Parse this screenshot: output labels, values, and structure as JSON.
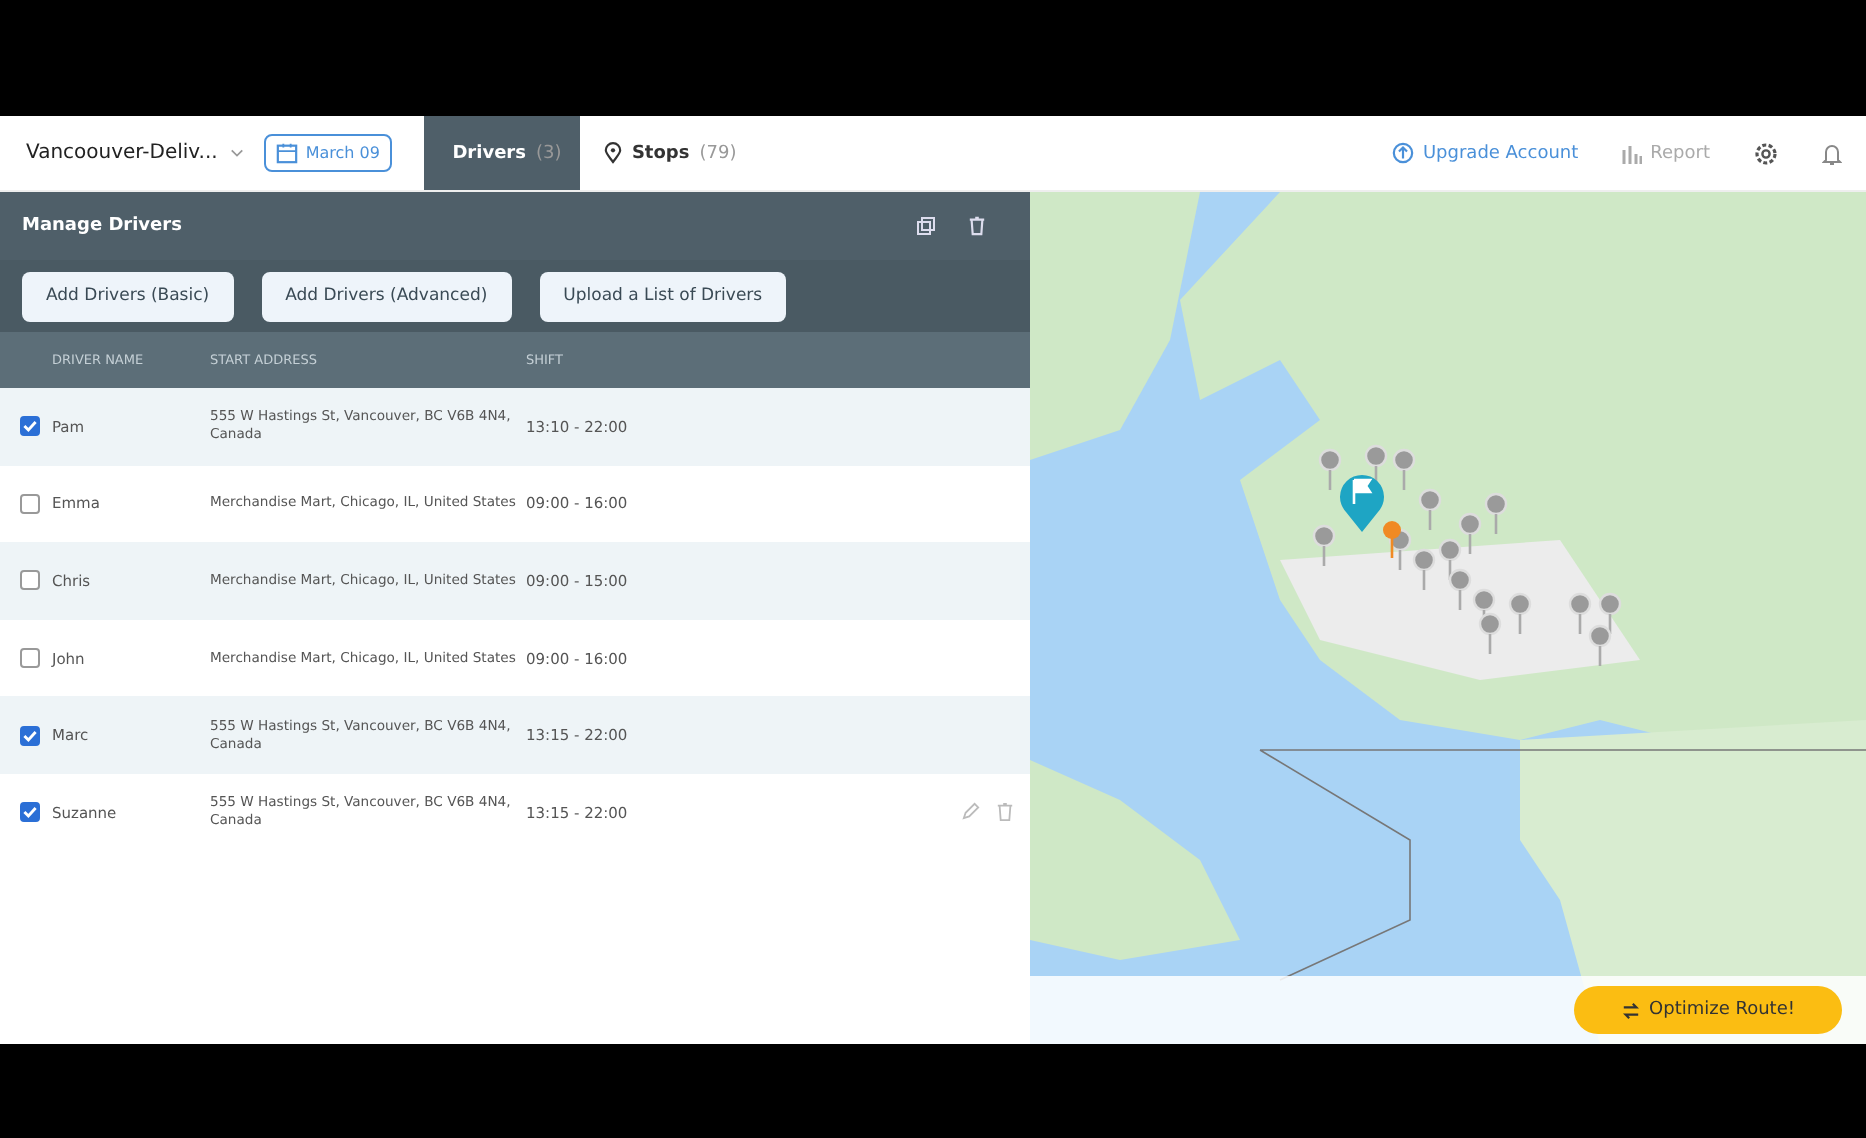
{
  "top_bar": {
    "route_name": "Vancoouver-Deliv...",
    "date": "March 09",
    "tabs": [
      {
        "label": "Drivers",
        "count": "(3)",
        "selected": true
      },
      {
        "label": "Stops",
        "count": "(79)",
        "selected": false
      }
    ],
    "upgrade": "Upgrade Account",
    "report": "Report"
  },
  "panel": {
    "title": "Manage Drivers",
    "buttons": [
      "Add Drivers (Basic)",
      "Add Drivers (Advanced)",
      "Upload a List of Drivers"
    ],
    "columns": [
      "DRIVER NAME",
      "START ADDRESS",
      "SHIFT"
    ],
    "rows": [
      {
        "name": "Pam",
        "address": "555 W Hastings St, Vancouver, BC V6B 4N4, Canada",
        "shift": "13:10 - 22:00",
        "checked": true,
        "show_actions": false
      },
      {
        "name": "Emma",
        "address": "Merchandise Mart, Chicago, IL, United States",
        "shift": "09:00 - 16:00",
        "checked": false,
        "show_actions": false
      },
      {
        "name": "Chris",
        "address": "Merchandise Mart, Chicago, IL, United States",
        "shift": "09:00 - 15:00",
        "checked": false,
        "show_actions": false
      },
      {
        "name": "John",
        "address": "Merchandise Mart, Chicago, IL, United States",
        "shift": "09:00 - 16:00",
        "checked": false,
        "show_actions": false
      },
      {
        "name": "Marc",
        "address": "555 W Hastings St, Vancouver, BC V6B 4N4, Canada",
        "shift": "13:15 - 22:00",
        "checked": true,
        "show_actions": false
      },
      {
        "name": "Suzanne",
        "address": "555 W Hastings St, Vancouver, BC V6B 4N4, Canada",
        "shift": "13:15 - 22:00",
        "checked": true,
        "show_actions": true
      }
    ]
  },
  "map": {
    "optimize_button": "Optimize Route!"
  }
}
